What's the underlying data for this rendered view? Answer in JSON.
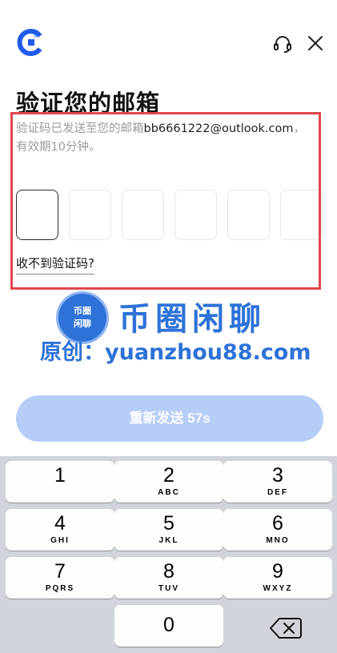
{
  "header": {
    "logo_icon": "brand-c-icon",
    "support_icon": "headset-icon",
    "close_icon": "close-icon"
  },
  "page": {
    "title": "验证您的邮箱",
    "desc_prefix": "验证码已发送至您的邮箱",
    "email": "bb6661222@outlook.com",
    "desc_sep": "，",
    "desc_suffix": "有效期10分钟。",
    "code_length": 6,
    "no_code_link": "收不到验证码?"
  },
  "watermark": {
    "badge_line1": "币圈",
    "badge_line2": "闲聊",
    "title": "币圈闲聊",
    "site_line": "原创：yuanzhou88.com"
  },
  "resend_button": {
    "label": "重新发送 57s"
  },
  "keypad": {
    "keys": [
      {
        "num": "1",
        "letters": ""
      },
      {
        "num": "2",
        "letters": "ABC"
      },
      {
        "num": "3",
        "letters": "DEF"
      },
      {
        "num": "4",
        "letters": "GHI"
      },
      {
        "num": "5",
        "letters": "JKL"
      },
      {
        "num": "6",
        "letters": "MNO"
      },
      {
        "num": "7",
        "letters": "PQRS"
      },
      {
        "num": "8",
        "letters": "TUV"
      },
      {
        "num": "9",
        "letters": "WXYZ"
      },
      {
        "num": "0",
        "letters": ""
      }
    ],
    "backspace_icon": "backspace-icon"
  },
  "colors": {
    "accent": "#2e72d8",
    "highlight_border": "#e0474e",
    "resend_bg": "#b6cdf7",
    "keypad_bg": "#d1d4da"
  }
}
